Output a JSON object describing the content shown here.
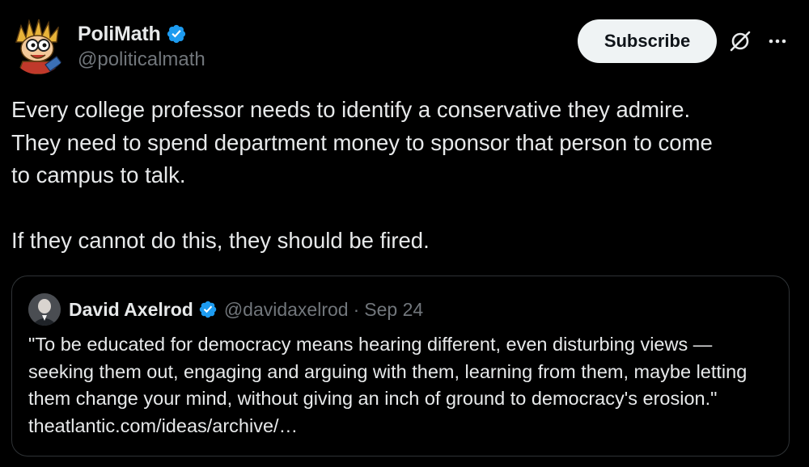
{
  "author": {
    "display_name": "PoliMath",
    "handle": "@politicalmath",
    "verified": true,
    "avatar_icon": "cartoon-avatar"
  },
  "actions": {
    "subscribe_label": "Subscribe",
    "grok_icon": "grok-icon",
    "more_icon": "more-icon"
  },
  "tweet": {
    "text": "Every college professor needs to identify a conservative they admire.\nThey need to spend department money to sponsor that person to come\nto campus to talk.\n\nIf they cannot do this, they should be fired."
  },
  "quote": {
    "display_name": "David Axelrod",
    "handle": "@davidaxelrod",
    "separator": "·",
    "date": "Sep 24",
    "verified": true,
    "text": "\"To be educated for democracy means hearing different, even disturbing views —seeking them out, engaging and arguing with them, learning from them, maybe letting them change your mind, without giving an inch of ground to democracy's erosion.\" theatlantic.com/ideas/archive/…"
  },
  "colors": {
    "background": "#000000",
    "text_primary": "#e7e9ea",
    "text_secondary": "#71767b",
    "verified_blue": "#1d9bf0",
    "border": "#2f3336",
    "button_bg": "#eff3f4"
  }
}
